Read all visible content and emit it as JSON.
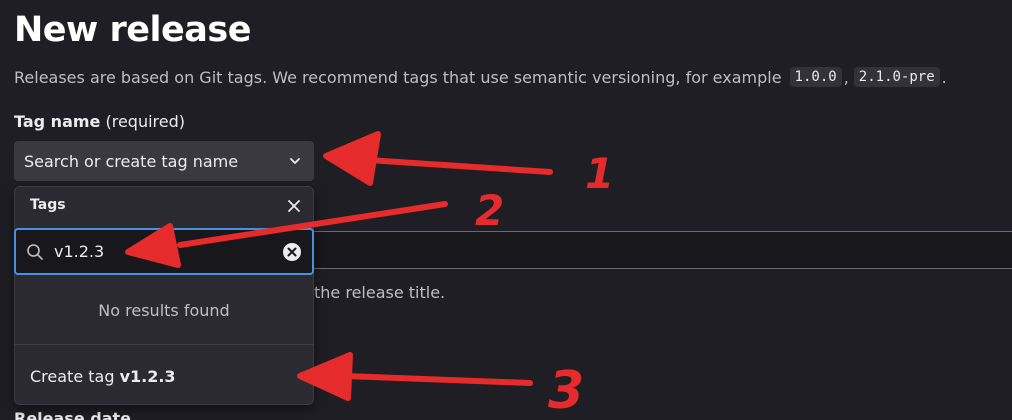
{
  "header": {
    "title": "New release",
    "description_prefix": "Releases are based on Git tags. We recommend tags that use semantic versioning, for example",
    "example_tag_1": "1.0.0",
    "separator": ",",
    "example_tag_2": "2.1.0-pre",
    "description_suffix": "."
  },
  "tag_field": {
    "label": "Tag name",
    "required_text": "(required)",
    "select_placeholder": "Search or create tag name"
  },
  "dropdown": {
    "header": "Tags",
    "search_value": "v1.2.3",
    "no_results": "No results found",
    "create_prefix": "Create tag",
    "create_tag_name": "v1.2.3"
  },
  "background": {
    "title_help": "the release title.",
    "release_date_label": "Release date"
  },
  "annotations": {
    "marker_1": "1",
    "marker_2": "2",
    "marker_3": "3",
    "color": "#e52b2b"
  }
}
